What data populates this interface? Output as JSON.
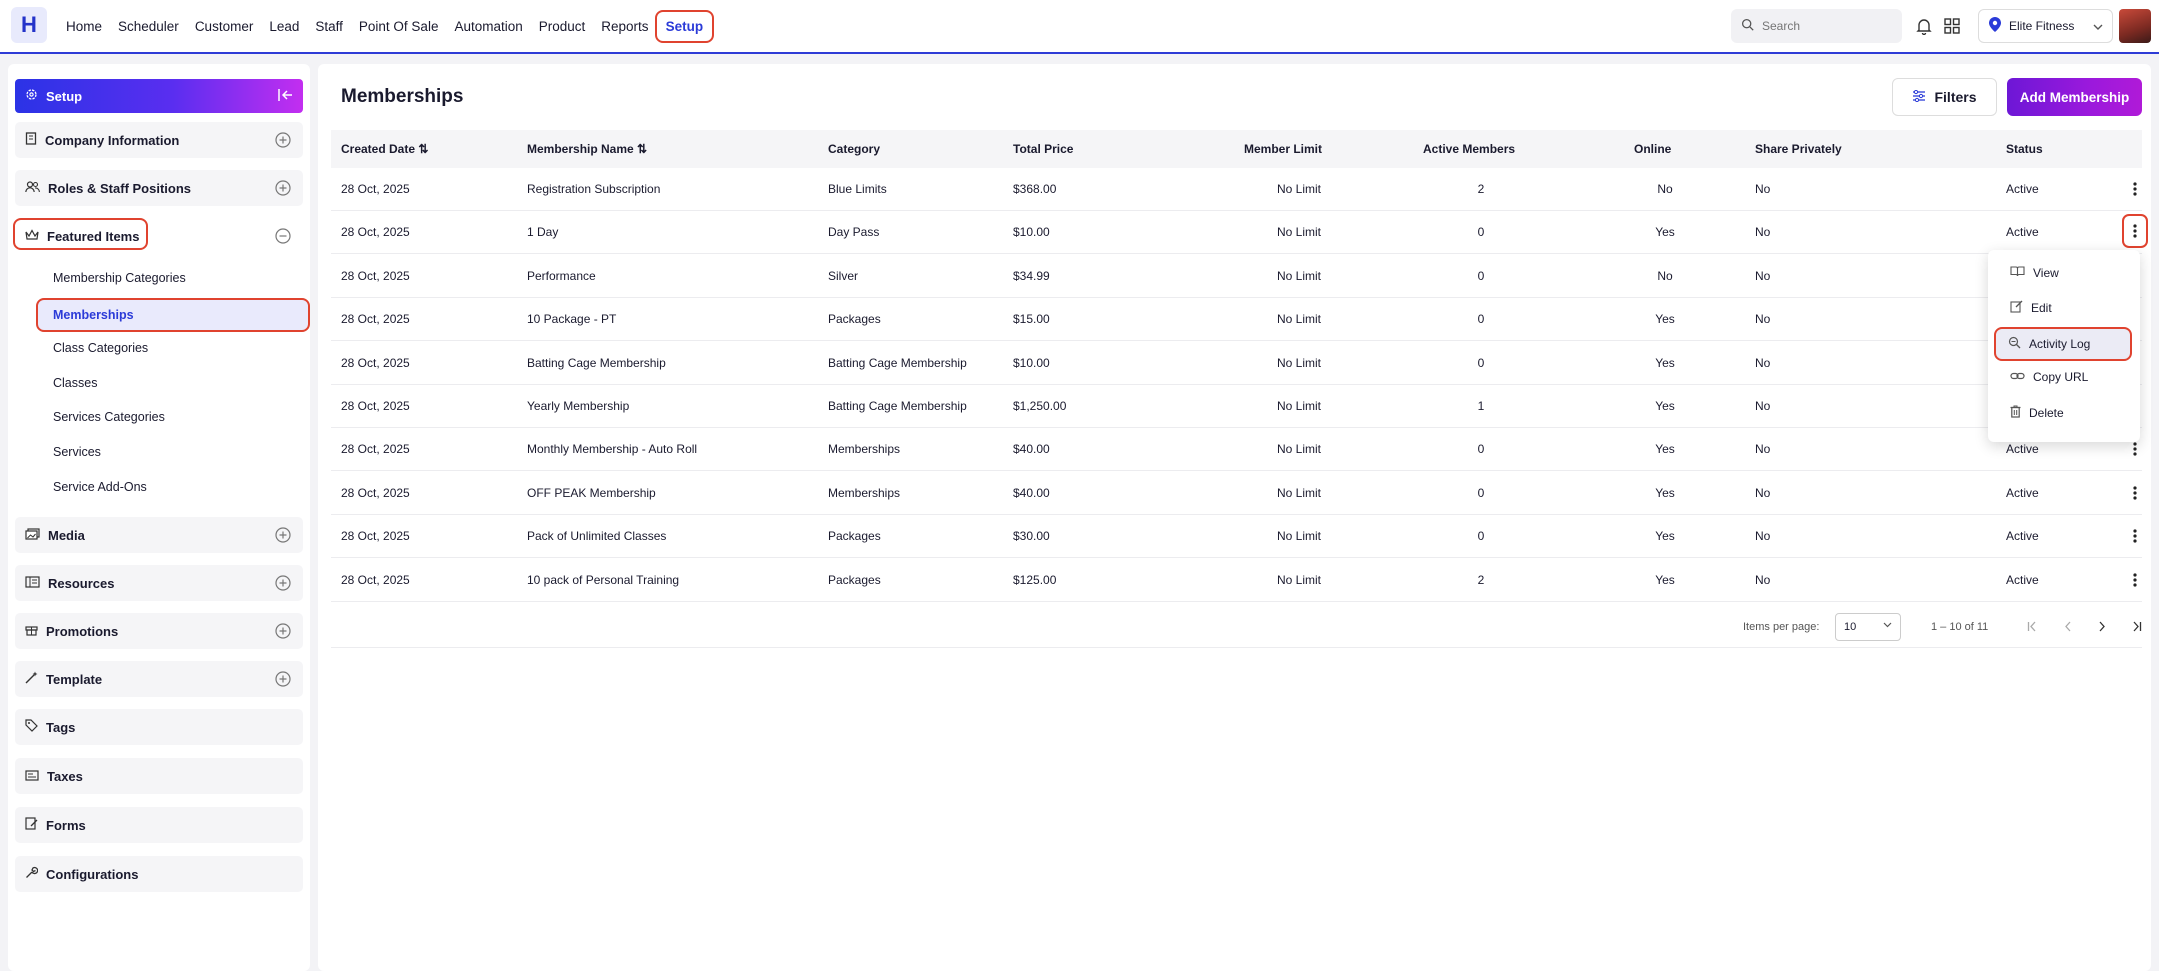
{
  "app": {
    "logo_letter": "H",
    "nav": [
      "Home",
      "Scheduler",
      "Customer",
      "Lead",
      "Staff",
      "Point Of Sale",
      "Automation",
      "Product",
      "Reports",
      "Setup"
    ],
    "search_placeholder": "Search",
    "location": "Elite Fitness",
    "accent_color": "#2b3bd8",
    "highlight_color": "#e0432f"
  },
  "sidebar": {
    "header": "Setup",
    "sections": [
      {
        "label": "Company Information",
        "icon": "building-icon",
        "toggle": "plus"
      },
      {
        "label": "Roles & Staff Positions",
        "icon": "users-icon",
        "toggle": "plus"
      },
      {
        "label": "Featured Items",
        "icon": "crown-icon",
        "toggle": "minus"
      },
      {
        "label": "Media",
        "icon": "media-icon",
        "toggle": "plus"
      },
      {
        "label": "Resources",
        "icon": "resources-icon",
        "toggle": "plus"
      },
      {
        "label": "Promotions",
        "icon": "gift-icon",
        "toggle": "plus"
      },
      {
        "label": "Template",
        "icon": "wand-icon",
        "toggle": "plus"
      },
      {
        "label": "Tags",
        "icon": "tag-icon"
      },
      {
        "label": "Taxes",
        "icon": "taxes-icon"
      },
      {
        "label": "Forms",
        "icon": "forms-icon"
      },
      {
        "label": "Configurations",
        "icon": "wrench-icon"
      }
    ],
    "featured_items": [
      "Membership Categories",
      "Memberships",
      "Class Categories",
      "Classes",
      "Services Categories",
      "Services",
      "Service Add-Ons"
    ]
  },
  "main": {
    "title": "Memberships",
    "filters_label": "Filters",
    "add_label": "Add Membership",
    "columns": [
      "Created Date",
      "Membership Name",
      "Category",
      "Total Price",
      "Member Limit",
      "Active Members",
      "Online",
      "Share Privately",
      "Status"
    ],
    "rows": [
      [
        "28 Oct, 2025",
        "Registration Subscription",
        "Blue Limits",
        "$368.00",
        "No Limit",
        "2",
        "No",
        "No",
        "Active"
      ],
      [
        "28 Oct, 2025",
        "1 Day",
        "Day Pass",
        "$10.00",
        "No Limit",
        "0",
        "Yes",
        "No",
        "Active"
      ],
      [
        "28 Oct, 2025",
        "Performance",
        "Silver",
        "$34.99",
        "No Limit",
        "0",
        "No",
        "No",
        ""
      ],
      [
        "28 Oct, 2025",
        "10 Package - PT",
        "Packages",
        "$15.00",
        "No Limit",
        "0",
        "Yes",
        "No",
        ""
      ],
      [
        "28 Oct, 2025",
        "Batting Cage Membership",
        "Batting Cage Membership",
        "$10.00",
        "No Limit",
        "0",
        "Yes",
        "No",
        ""
      ],
      [
        "28 Oct, 2025",
        "Yearly Membership",
        "Batting Cage Membership",
        "$1,250.00",
        "No Limit",
        "1",
        "Yes",
        "No",
        ""
      ],
      [
        "28 Oct, 2025",
        "Monthly Membership - Auto Roll",
        "Memberships",
        "$40.00",
        "No Limit",
        "0",
        "Yes",
        "No",
        "Active"
      ],
      [
        "28 Oct, 2025",
        "OFF PEAK Membership",
        "Memberships",
        "$40.00",
        "No Limit",
        "0",
        "Yes",
        "No",
        "Active"
      ],
      [
        "28 Oct, 2025",
        "Pack of Unlimited Classes",
        "Packages",
        "$30.00",
        "No Limit",
        "0",
        "Yes",
        "No",
        "Active"
      ],
      [
        "28 Oct, 2025",
        "10 pack of Personal Training",
        "Packages",
        "$125.00",
        "No Limit",
        "2",
        "Yes",
        "No",
        "Active"
      ]
    ],
    "pagination": {
      "items_per_page_label": "Items per page:",
      "items_per_page": "10",
      "range": "1 – 10 of 11"
    }
  },
  "row_menu": {
    "items": [
      {
        "label": "View",
        "icon": "book-icon"
      },
      {
        "label": "Edit",
        "icon": "edit-icon"
      },
      {
        "label": "Activity Log",
        "icon": "search-zoom-icon"
      },
      {
        "label": "Copy URL",
        "icon": "link-icon"
      },
      {
        "label": "Delete",
        "icon": "trash-icon"
      }
    ]
  }
}
